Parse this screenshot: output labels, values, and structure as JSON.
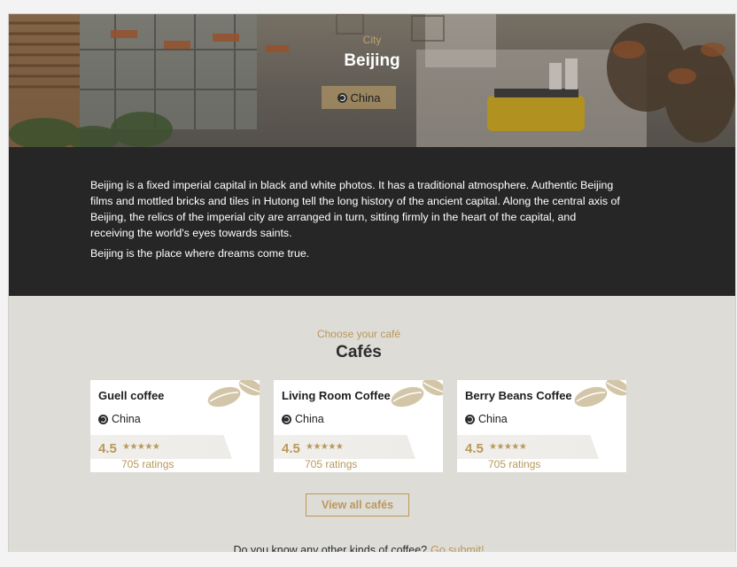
{
  "hero": {
    "label": "City",
    "title": "Beijing",
    "country": "China"
  },
  "description": {
    "paragraph1": "Beijing is a fixed imperial capital in black and white photos. It has a traditional atmosphere. Authentic Beijing films and mottled bricks and tiles in Hutong tell the long history of the ancient capital. Along the central axis of Beijing, the relics of the imperial city are arranged in turn, sitting firmly in the heart of the capital, and receiving the world's eyes towards saints.",
    "paragraph2": "Beijing is the place where dreams come true."
  },
  "cafes": {
    "kicker": "Choose your café",
    "title": "Cafés",
    "items": [
      {
        "name": "Guell coffee",
        "country": "China",
        "score": "4.5",
        "stars": "★★★★★",
        "ratings": "705 ratings"
      },
      {
        "name": "Living Room Coffee",
        "country": "China",
        "score": "4.5",
        "stars": "★★★★★",
        "ratings": "705 ratings"
      },
      {
        "name": "Berry Beans Coffee",
        "country": "China",
        "score": "4.5",
        "stars": "★★★★★",
        "ratings": "705 ratings"
      }
    ],
    "view_all": "View all cafés"
  },
  "footer": {
    "question": "Do you know any other kinds of coffee?",
    "submit_link": "Go submit!"
  },
  "colors": {
    "accent": "#b9985a",
    "dark": "#262626"
  },
  "icons": [
    "globe-icon",
    "coffee-beans-icon",
    "star-icon"
  ]
}
